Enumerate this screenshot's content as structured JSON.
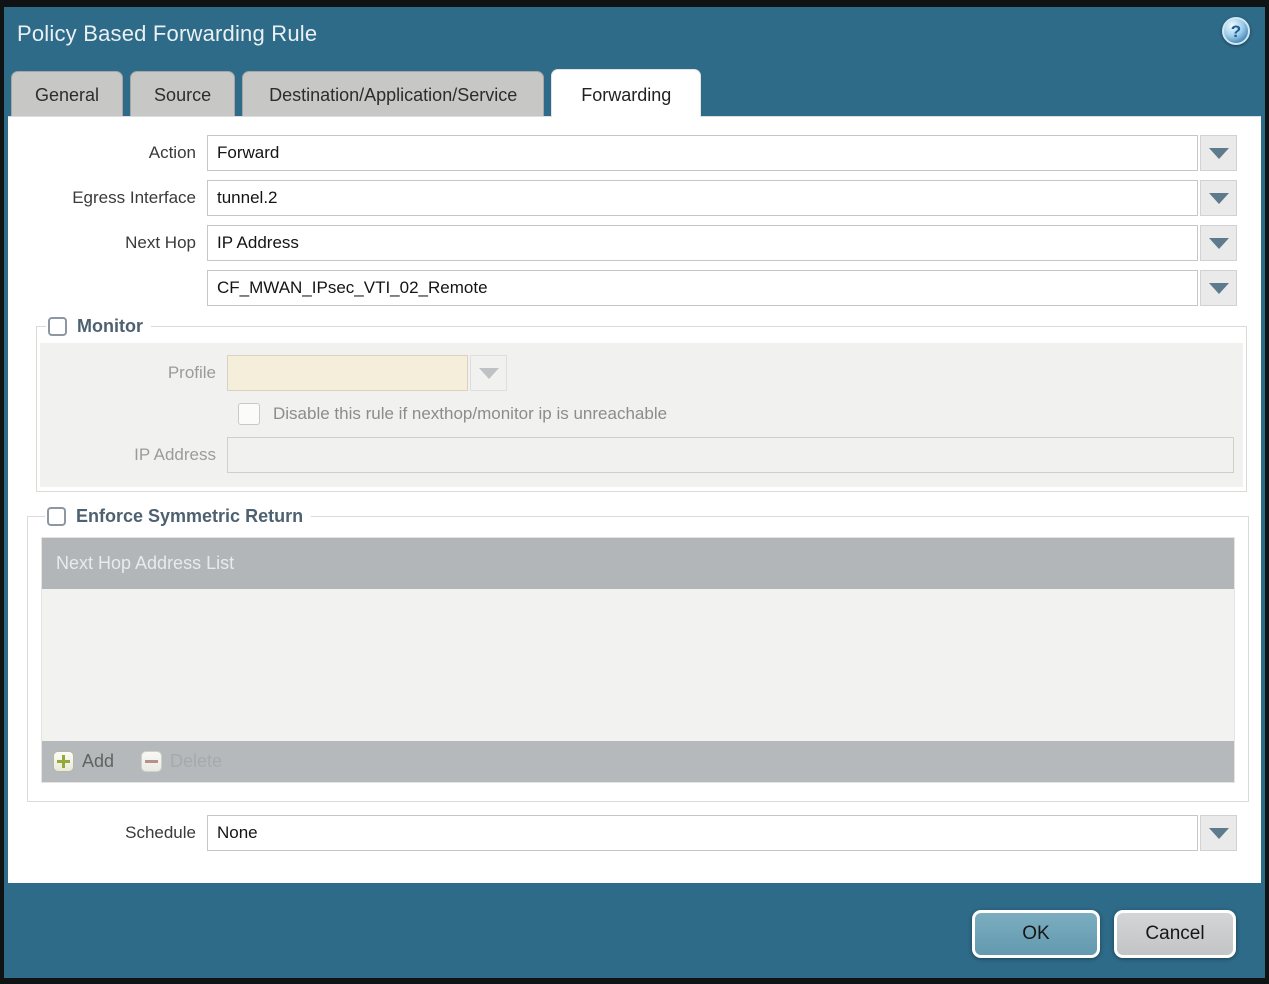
{
  "window": {
    "title": "Policy Based Forwarding Rule"
  },
  "icons": {
    "help": "?"
  },
  "tabs": [
    {
      "label": "General",
      "active": false
    },
    {
      "label": "Source",
      "active": false
    },
    {
      "label": "Destination/Application/Service",
      "active": false
    },
    {
      "label": "Forwarding",
      "active": true
    }
  ],
  "form": {
    "action": {
      "label": "Action",
      "value": "Forward"
    },
    "egress_interface": {
      "label": "Egress Interface",
      "value": "tunnel.2"
    },
    "next_hop": {
      "label": "Next Hop",
      "value": "IP Address"
    },
    "next_hop_address": {
      "value": "CF_MWAN_IPsec_VTI_02_Remote"
    },
    "schedule": {
      "label": "Schedule",
      "value": "None"
    }
  },
  "monitor": {
    "legend": "Monitor",
    "checked": false,
    "profile": {
      "label": "Profile",
      "value": ""
    },
    "disable_rule": {
      "label": "Disable this rule if nexthop/monitor ip is unreachable",
      "checked": false
    },
    "ip_address": {
      "label": "IP Address",
      "value": ""
    }
  },
  "symmetric_return": {
    "legend": "Enforce Symmetric Return",
    "checked": false,
    "table": {
      "header": "Next Hop Address List",
      "rows": []
    },
    "toolbar": {
      "add_label": "Add",
      "delete_label": "Delete"
    }
  },
  "footer": {
    "ok_label": "OK",
    "cancel_label": "Cancel"
  },
  "colors": {
    "dialog_teal": "#2e6b88",
    "ok_button": "#6ea2b6",
    "cancel_button": "#c9cbcd",
    "disabled_field_beige": "#f5eedb",
    "table_header_gray": "#b2b6b8",
    "legend_text": "#4e6170",
    "add_icon_green": "#93a93e",
    "delete_icon_red": "#a36f69"
  }
}
